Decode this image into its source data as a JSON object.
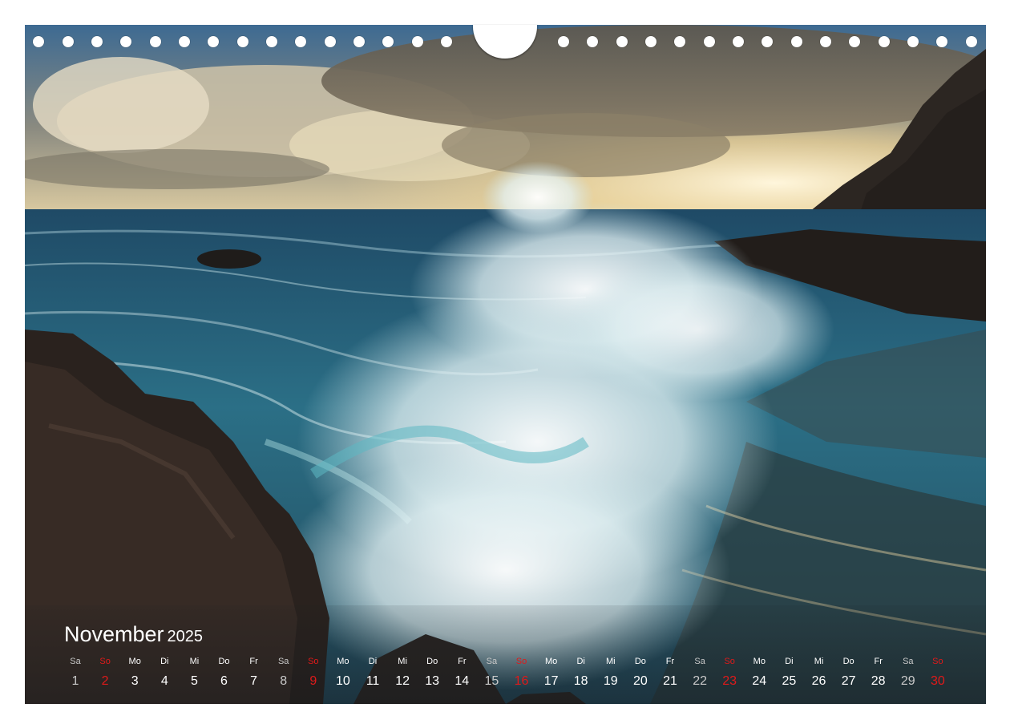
{
  "calendar": {
    "month": "November",
    "year": "2025",
    "days": [
      {
        "wd": "Sa",
        "n": "1"
      },
      {
        "wd": "So",
        "n": "2"
      },
      {
        "wd": "Mo",
        "n": "3"
      },
      {
        "wd": "Di",
        "n": "4"
      },
      {
        "wd": "Mi",
        "n": "5"
      },
      {
        "wd": "Do",
        "n": "6"
      },
      {
        "wd": "Fr",
        "n": "7"
      },
      {
        "wd": "Sa",
        "n": "8"
      },
      {
        "wd": "So",
        "n": "9"
      },
      {
        "wd": "Mo",
        "n": "10"
      },
      {
        "wd": "Di",
        "n": "11"
      },
      {
        "wd": "Mi",
        "n": "12"
      },
      {
        "wd": "Do",
        "n": "13"
      },
      {
        "wd": "Fr",
        "n": "14"
      },
      {
        "wd": "Sa",
        "n": "15"
      },
      {
        "wd": "So",
        "n": "16"
      },
      {
        "wd": "Mo",
        "n": "17"
      },
      {
        "wd": "Di",
        "n": "18"
      },
      {
        "wd": "Mi",
        "n": "19"
      },
      {
        "wd": "Do",
        "n": "20"
      },
      {
        "wd": "Fr",
        "n": "21"
      },
      {
        "wd": "Sa",
        "n": "22"
      },
      {
        "wd": "So",
        "n": "23"
      },
      {
        "wd": "Mo",
        "n": "24"
      },
      {
        "wd": "Di",
        "n": "25"
      },
      {
        "wd": "Mi",
        "n": "26"
      },
      {
        "wd": "Do",
        "n": "27"
      },
      {
        "wd": "Fr",
        "n": "28"
      },
      {
        "wd": "Sa",
        "n": "29"
      },
      {
        "wd": "So",
        "n": "30"
      }
    ]
  },
  "colors": {
    "text": "#ffffff",
    "weekend_sat": "#c9c9c9",
    "weekend_sun": "#e01a1a"
  }
}
